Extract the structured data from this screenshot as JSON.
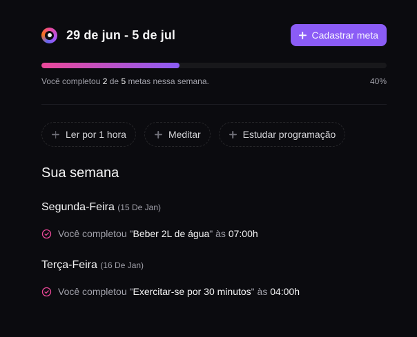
{
  "header": {
    "date_range": "29 de jun - 5 de jul",
    "add_button_label": "Cadastrar meta"
  },
  "progress": {
    "completed": "2",
    "total": "5",
    "percent_label": "40%",
    "percent_value": 40,
    "text_prefix": "Você completou ",
    "text_of": " de ",
    "text_suffix": " metas nessa semana."
  },
  "pending_goals": [
    {
      "label": "Ler por 1 hora"
    },
    {
      "label": "Meditar"
    },
    {
      "label": "Estudar programação"
    }
  ],
  "week": {
    "title": "Sua semana",
    "days": [
      {
        "name": "Segunda-Feira",
        "date": "(15 De Jan)",
        "entries": [
          {
            "prefix": "Você completou \"",
            "goal": "Beber 2L de água",
            "mid": "\" às ",
            "time": "07:00h"
          }
        ]
      },
      {
        "name": "Terça-Feira",
        "date": "(16 De Jan)",
        "entries": [
          {
            "prefix": "Você completou \"",
            "goal": "Exercitar-se por 30 minutos",
            "mid": "\" às ",
            "time": "04:00h"
          }
        ]
      }
    ]
  },
  "colors": {
    "background": "#0b0b0f",
    "accent": "#8b5cf6",
    "gradient_start": "#ec4899",
    "check": "#ec4899"
  },
  "icons": {
    "logo": "app-logo-icon",
    "add": "plus-icon",
    "check": "circle-check-icon"
  }
}
